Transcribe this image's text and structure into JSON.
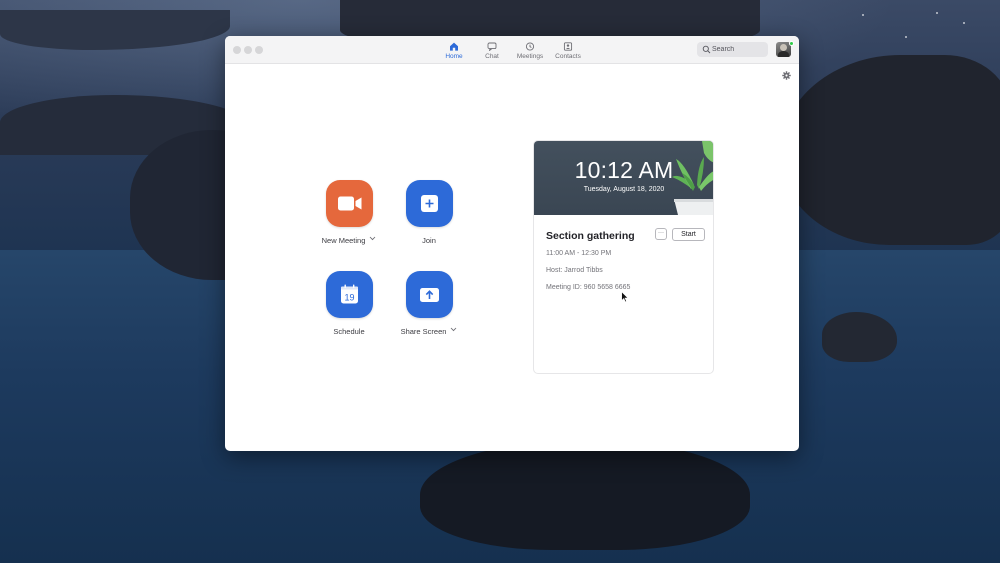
{
  "nav": {
    "tabs": [
      {
        "label": "Home",
        "icon": "home-icon",
        "active": true
      },
      {
        "label": "Chat",
        "icon": "chat-bubble-icon",
        "active": false
      },
      {
        "label": "Meetings",
        "icon": "clock-icon",
        "active": false
      },
      {
        "label": "Contacts",
        "icon": "contact-card-icon",
        "active": false
      }
    ],
    "search_placeholder": "Search"
  },
  "actions": [
    {
      "label": "New Meeting",
      "icon": "video-camera-icon",
      "has_dropdown": true,
      "color": "#e5683c"
    },
    {
      "label": "Join",
      "icon": "plus-icon",
      "has_dropdown": false,
      "color": "#2d6ad8"
    },
    {
      "label": "Schedule",
      "icon": "calendar-icon",
      "calendar_day": "19",
      "has_dropdown": false,
      "color": "#2d6ad8"
    },
    {
      "label": "Share Screen",
      "icon": "share-upload-icon",
      "has_dropdown": true,
      "color": "#2d6ad8"
    }
  ],
  "upcoming": {
    "time": "10:12 AM",
    "date": "Tuesday, August 18, 2020",
    "meeting": {
      "title": "Section gathering",
      "more_label": "···",
      "start_label": "Start",
      "time_range": "11:00 AM - 12:30 PM",
      "host": "Host: Jarrod Tibbs",
      "meeting_id": "Meeting ID: 960 5658 6665"
    }
  },
  "colors": {
    "accent_blue": "#2d6ad8",
    "new_meeting_orange": "#e5683c",
    "presence_green": "#2ecc47"
  }
}
